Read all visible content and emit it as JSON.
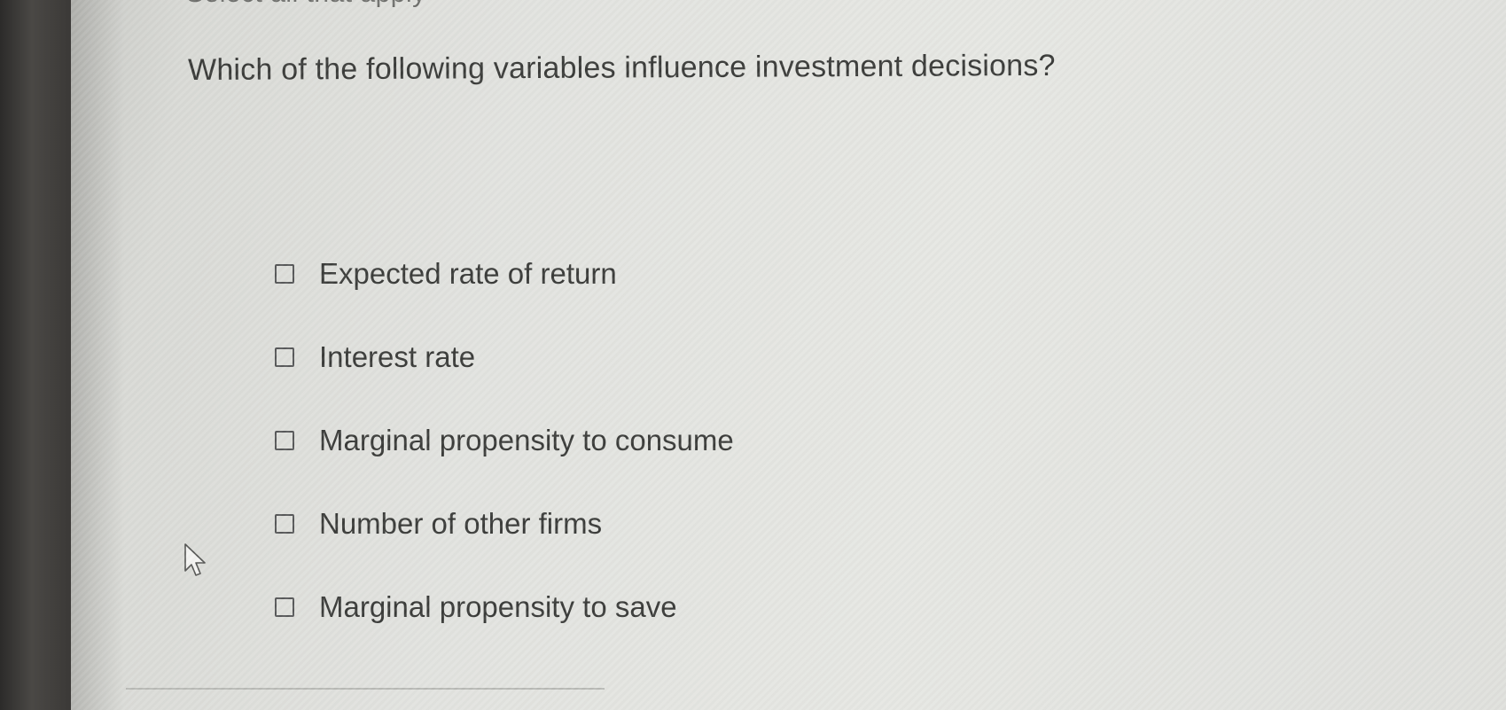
{
  "header": {
    "instruction": "Select all that apply"
  },
  "question": {
    "text": "Which of the following variables influence investment decisions?"
  },
  "options": [
    {
      "label": "Expected rate of return",
      "checked": false
    },
    {
      "label": "Interest rate",
      "checked": false
    },
    {
      "label": "Marginal propensity to consume",
      "checked": false
    },
    {
      "label": "Number of other firms",
      "checked": false
    },
    {
      "label": "Marginal propensity to save",
      "checked": false
    }
  ],
  "cursor": {
    "icon": "arrow-pointer-icon"
  }
}
